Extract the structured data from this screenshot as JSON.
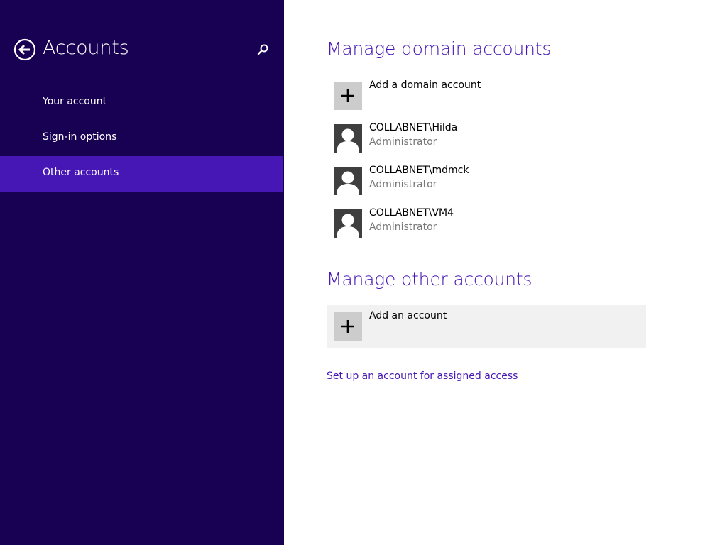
{
  "sidebar": {
    "title": "Accounts",
    "back_icon": "back-arrow-icon",
    "search_icon": "search-icon",
    "items": [
      {
        "label": "Your account",
        "selected": false
      },
      {
        "label": "Sign-in options",
        "selected": false
      },
      {
        "label": "Other accounts",
        "selected": true
      }
    ]
  },
  "main": {
    "domain_section": {
      "title": "Manage domain accounts",
      "add_label": "Add a domain account",
      "accounts": [
        {
          "name": "COLLABNET\\Hilda",
          "role": "Administrator"
        },
        {
          "name": "COLLABNET\\mdmck",
          "role": "Administrator"
        },
        {
          "name": "COLLABNET\\VM4",
          "role": "Administrator"
        }
      ]
    },
    "other_section": {
      "title": "Manage other accounts",
      "add_label": "Add an account"
    },
    "assigned_access_link": "Set up an account for assigned access"
  },
  "colors": {
    "sidebar_bg": "#180052",
    "accent": "#4617b4",
    "selected_bg": "#4617b4"
  }
}
